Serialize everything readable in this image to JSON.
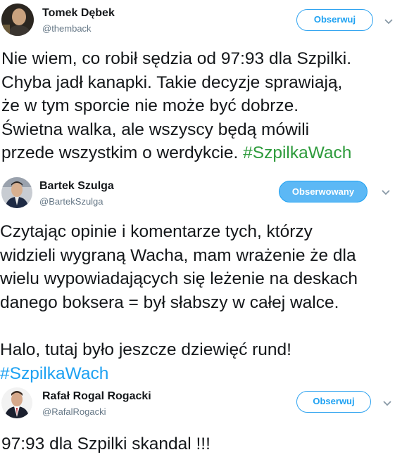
{
  "tweets": [
    {
      "author": "Tomek Dębek",
      "handle": "@themback",
      "follow_label": "Obserwuj",
      "text": "Nie wiem, co robił sędzia od 97:93 dla Szpilki.\nChyba jadł kanapki. Takie decyzje sprawiają,\nże w tym sporcie nie może być dobrze.\nŚwietna walka, ale wszyscy będą mówili\nprzede wszystkim o werdykcie. ",
      "hashtag": "#SzpilkaWach"
    },
    {
      "author": "Bartek Szulga",
      "handle": "@BartekSzulga",
      "follow_label": "Obserwowany",
      "text": "Czytając opinie i komentarze tych, którzy\nwidzieli wygraną Wacha, mam wrażenie że dla\nwielu wypowiadających się leżenie na deskach\ndanego boksera = był słabszy w całej walce.\n\nHalo, tutaj było jeszcze dziewięć rund!\n",
      "hashtag": "#SzpilkaWach"
    },
    {
      "author": "Rafał Rogal Rogacki",
      "handle": "@RafalRogacki",
      "follow_label": "Obserwuj",
      "text": "97:93 dla Szpilki skandal !!!",
      "hashtag": ""
    }
  ],
  "colors": {
    "link_blue": "#1da1f2",
    "hashtag_green": "#2e9b3c",
    "secondary": "#657786"
  }
}
